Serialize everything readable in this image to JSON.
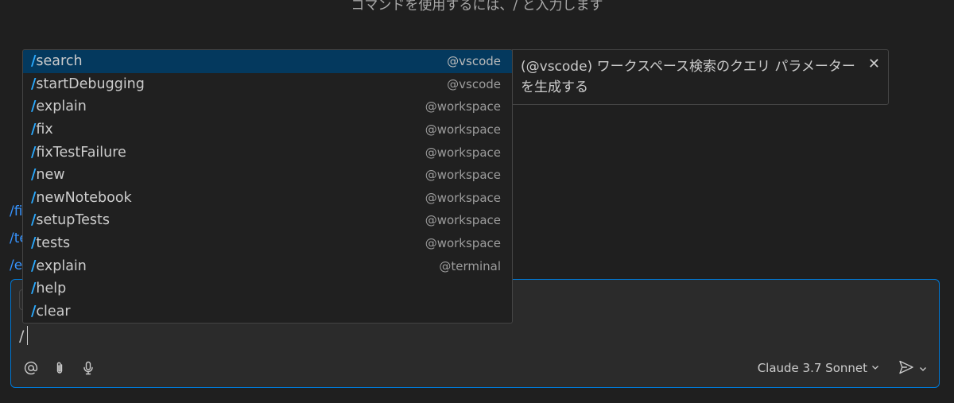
{
  "hint": "コマンドを使用するには、/ と入力します",
  "history": [
    "/fix",
    "/tests",
    "/explain"
  ],
  "suggest": {
    "items": [
      {
        "slash": "/",
        "name": "search",
        "detail": "@vscode",
        "selected": true
      },
      {
        "slash": "/",
        "name": "startDebugging",
        "detail": "@vscode"
      },
      {
        "slash": "/",
        "name": "explain",
        "detail": "@workspace"
      },
      {
        "slash": "/",
        "name": "fix",
        "detail": "@workspace"
      },
      {
        "slash": "/",
        "name": "fixTestFailure",
        "detail": "@workspace"
      },
      {
        "slash": "/",
        "name": "new",
        "detail": "@workspace"
      },
      {
        "slash": "/",
        "name": "newNotebook",
        "detail": "@workspace"
      },
      {
        "slash": "/",
        "name": "setupTests",
        "detail": "@workspace"
      },
      {
        "slash": "/",
        "name": "tests",
        "detail": "@workspace"
      },
      {
        "slash": "/",
        "name": "explain",
        "detail": "@terminal"
      },
      {
        "slash": "/",
        "name": "help",
        "detail": ""
      },
      {
        "slash": "/",
        "name": "clear",
        "detail": ""
      }
    ]
  },
  "details": {
    "text": "(@vscode) ワークスペース検索のクエリ パラメーターを生成する",
    "close_icon": "close-icon"
  },
  "input": {
    "value": "/"
  },
  "toolbar": {
    "mention_icon": "at-icon",
    "attach_icon": "paperclip-icon",
    "mic_icon": "microphone-icon",
    "model": "Claude 3.7 Sonnet",
    "send_icon": "send-icon"
  },
  "colors": {
    "accent": "#0078d4",
    "selected_row": "#04395e",
    "slash": "#2aaaff",
    "background": "#1f1f1f"
  }
}
